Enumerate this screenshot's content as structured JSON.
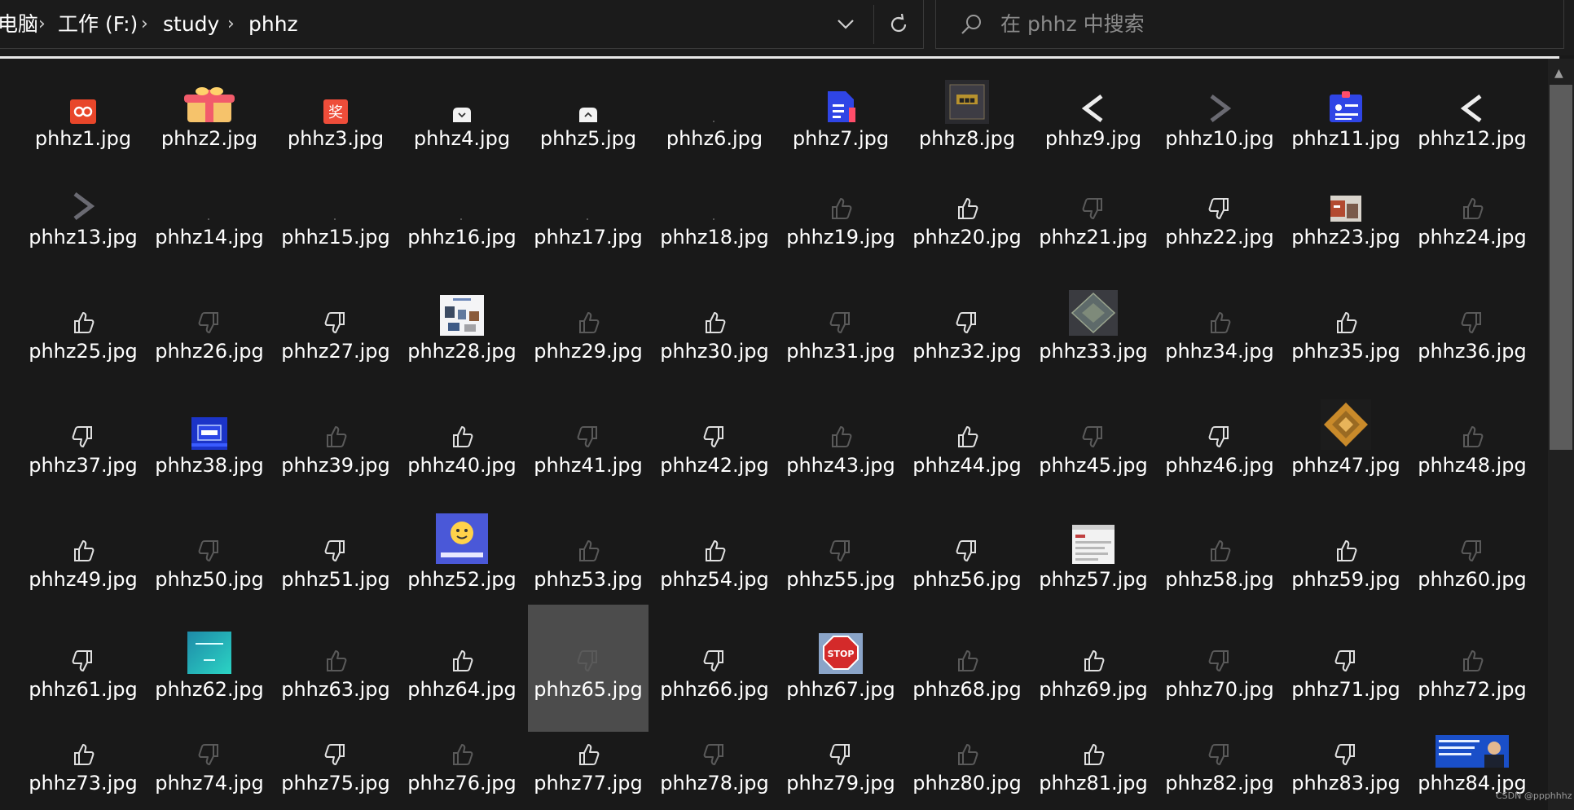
{
  "address_bar": {
    "crumbs": [
      "电脑",
      "工作 (F:)",
      "study",
      "phhz"
    ],
    "separator": "›",
    "dropdown_icon": "chevron-down-icon",
    "refresh_icon": "refresh-icon"
  },
  "search": {
    "placeholder": "在 phhz 中搜索",
    "icon": "search-icon"
  },
  "files": [
    {
      "name": "phhz1.jpg",
      "thumb": "red-logo"
    },
    {
      "name": "phhz2.jpg",
      "thumb": "gift-box"
    },
    {
      "name": "phhz3.jpg",
      "thumb": "red-award"
    },
    {
      "name": "phhz4.jpg",
      "thumb": "white-tab-down"
    },
    {
      "name": "phhz5.jpg",
      "thumb": "white-tab-up"
    },
    {
      "name": "phhz6.jpg",
      "thumb": "blank"
    },
    {
      "name": "phhz7.jpg",
      "thumb": "blue-doc"
    },
    {
      "name": "phhz8.jpg",
      "thumb": "chip"
    },
    {
      "name": "phhz9.jpg",
      "thumb": "chevron-left"
    },
    {
      "name": "phhz10.jpg",
      "thumb": "chevron-right-dim"
    },
    {
      "name": "phhz11.jpg",
      "thumb": "blue-card"
    },
    {
      "name": "phhz12.jpg",
      "thumb": "chevron-left"
    },
    {
      "name": "phhz13.jpg",
      "thumb": "chevron-right-dim"
    },
    {
      "name": "phhz14.jpg",
      "thumb": "blank"
    },
    {
      "name": "phhz15.jpg",
      "thumb": "blank"
    },
    {
      "name": "phhz16.jpg",
      "thumb": "blank"
    },
    {
      "name": "phhz17.jpg",
      "thumb": "blank"
    },
    {
      "name": "phhz18.jpg",
      "thumb": "blank"
    },
    {
      "name": "phhz19.jpg",
      "thumb": "thumbs-up-dim"
    },
    {
      "name": "phhz20.jpg",
      "thumb": "thumbs-up"
    },
    {
      "name": "phhz21.jpg",
      "thumb": "thumbs-down-dim"
    },
    {
      "name": "phhz22.jpg",
      "thumb": "thumbs-down"
    },
    {
      "name": "phhz23.jpg",
      "thumb": "photo-small"
    },
    {
      "name": "phhz24.jpg",
      "thumb": "thumbs-up-dim"
    },
    {
      "name": "phhz25.jpg",
      "thumb": "thumbs-up"
    },
    {
      "name": "phhz26.jpg",
      "thumb": "thumbs-down-dim"
    },
    {
      "name": "phhz27.jpg",
      "thumb": "thumbs-down"
    },
    {
      "name": "phhz28.jpg",
      "thumb": "slide-photo"
    },
    {
      "name": "phhz29.jpg",
      "thumb": "thumbs-up-dim"
    },
    {
      "name": "phhz30.jpg",
      "thumb": "thumbs-up"
    },
    {
      "name": "phhz31.jpg",
      "thumb": "thumbs-down-dim"
    },
    {
      "name": "phhz32.jpg",
      "thumb": "thumbs-down"
    },
    {
      "name": "phhz33.jpg",
      "thumb": "chip-photo"
    },
    {
      "name": "phhz34.jpg",
      "thumb": "thumbs-up-dim"
    },
    {
      "name": "phhz35.jpg",
      "thumb": "thumbs-up"
    },
    {
      "name": "phhz36.jpg",
      "thumb": "thumbs-down-dim"
    },
    {
      "name": "phhz37.jpg",
      "thumb": "thumbs-down"
    },
    {
      "name": "phhz38.jpg",
      "thumb": "blue-board"
    },
    {
      "name": "phhz39.jpg",
      "thumb": "thumbs-up-dim"
    },
    {
      "name": "phhz40.jpg",
      "thumb": "thumbs-up"
    },
    {
      "name": "phhz41.jpg",
      "thumb": "thumbs-down-dim"
    },
    {
      "name": "phhz42.jpg",
      "thumb": "thumbs-down"
    },
    {
      "name": "phhz43.jpg",
      "thumb": "thumbs-up-dim"
    },
    {
      "name": "phhz44.jpg",
      "thumb": "thumbs-up"
    },
    {
      "name": "phhz45.jpg",
      "thumb": "thumbs-down-dim"
    },
    {
      "name": "phhz46.jpg",
      "thumb": "thumbs-down"
    },
    {
      "name": "phhz47.jpg",
      "thumb": "cpu-photo"
    },
    {
      "name": "phhz48.jpg",
      "thumb": "thumbs-up-dim"
    },
    {
      "name": "phhz49.jpg",
      "thumb": "thumbs-up"
    },
    {
      "name": "phhz50.jpg",
      "thumb": "thumbs-down-dim"
    },
    {
      "name": "phhz51.jpg",
      "thumb": "thumbs-down"
    },
    {
      "name": "phhz52.jpg",
      "thumb": "hugging-face"
    },
    {
      "name": "phhz53.jpg",
      "thumb": "thumbs-up-dim"
    },
    {
      "name": "phhz54.jpg",
      "thumb": "thumbs-up"
    },
    {
      "name": "phhz55.jpg",
      "thumb": "thumbs-down-dim"
    },
    {
      "name": "phhz56.jpg",
      "thumb": "thumbs-down"
    },
    {
      "name": "phhz57.jpg",
      "thumb": "screenshot-white"
    },
    {
      "name": "phhz58.jpg",
      "thumb": "thumbs-up-dim"
    },
    {
      "name": "phhz59.jpg",
      "thumb": "thumbs-up"
    },
    {
      "name": "phhz60.jpg",
      "thumb": "thumbs-down-dim"
    },
    {
      "name": "phhz61.jpg",
      "thumb": "thumbs-down"
    },
    {
      "name": "phhz62.jpg",
      "thumb": "teal-slide"
    },
    {
      "name": "phhz63.jpg",
      "thumb": "thumbs-up-dim"
    },
    {
      "name": "phhz64.jpg",
      "thumb": "thumbs-up"
    },
    {
      "name": "phhz65.jpg",
      "thumb": "thumbs-down-dim"
    },
    {
      "name": "phhz66.jpg",
      "thumb": "thumbs-down"
    },
    {
      "name": "phhz67.jpg",
      "thumb": "stop-sign"
    },
    {
      "name": "phhz68.jpg",
      "thumb": "thumbs-up-dim"
    },
    {
      "name": "phhz69.jpg",
      "thumb": "thumbs-up"
    },
    {
      "name": "phhz70.jpg",
      "thumb": "thumbs-down-dim"
    },
    {
      "name": "phhz71.jpg",
      "thumb": "thumbs-down"
    },
    {
      "name": "phhz72.jpg",
      "thumb": "thumbs-up-dim"
    },
    {
      "name": "phhz73.jpg",
      "thumb": "thumbs-up"
    },
    {
      "name": "phhz74.jpg",
      "thumb": "thumbs-down-dim"
    },
    {
      "name": "phhz75.jpg",
      "thumb": "thumbs-down"
    },
    {
      "name": "phhz76.jpg",
      "thumb": "thumbs-up-dim"
    },
    {
      "name": "phhz77.jpg",
      "thumb": "thumbs-up"
    },
    {
      "name": "phhz78.jpg",
      "thumb": "thumbs-down-dim"
    },
    {
      "name": "phhz79.jpg",
      "thumb": "thumbs-down"
    },
    {
      "name": "phhz80.jpg",
      "thumb": "thumbs-up-dim"
    },
    {
      "name": "phhz81.jpg",
      "thumb": "thumbs-up"
    },
    {
      "name": "phhz82.jpg",
      "thumb": "thumbs-down-dim"
    },
    {
      "name": "phhz83.jpg",
      "thumb": "thumbs-down"
    },
    {
      "name": "phhz84.jpg",
      "thumb": "news-photo"
    }
  ],
  "selected_file": "phhz65.jpg",
  "watermark": "CSDN @ppphhhz",
  "colors": {
    "background": "#191919",
    "text": "#ffffff",
    "selection": "#4c4c4c",
    "icon_light": "#e0e0e0",
    "icon_dim": "#5a5a5a"
  }
}
